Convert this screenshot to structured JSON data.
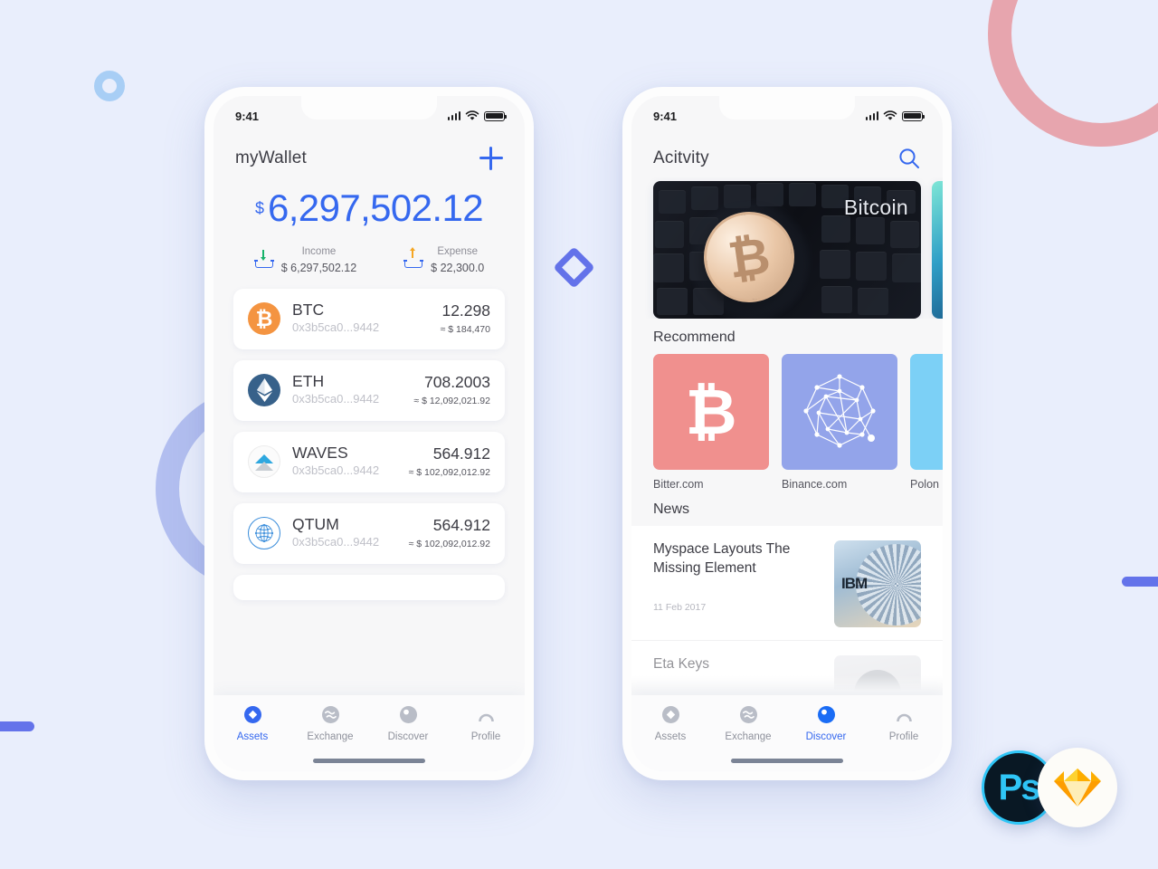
{
  "background": {
    "page_bg": "#e9eefc",
    "accent_blue": "#3568ef",
    "deco_pink": "#e7a5ae",
    "deco_periwinkle": "#b3bff0",
    "deco_lightblue": "#a8cef5",
    "deco_indigo": "#6473ea"
  },
  "wallet_screen": {
    "status": {
      "time": "9:41"
    },
    "header": {
      "title": "myWallet",
      "add_icon": "plus-icon"
    },
    "balance": {
      "currency_symbol": "$",
      "amount": "6,297,502.12"
    },
    "flows": [
      {
        "label": "Income",
        "value": "$ 6,297,502.12",
        "icon": "tray-download-icon"
      },
      {
        "label": "Expense",
        "value": "$ 22,300.0",
        "icon": "tray-upload-icon"
      }
    ],
    "assets": [
      {
        "symbol": "BTC",
        "address": "0x3b5ca0...9442",
        "qty": "12.298",
        "fiat": "≈ $ 184,470",
        "icon": "bitcoin-icon"
      },
      {
        "symbol": "ETH",
        "address": "0x3b5ca0...9442",
        "qty": "708.2003",
        "fiat": "≈ $ 12,092,021.92",
        "icon": "ethereum-icon"
      },
      {
        "symbol": "WAVES",
        "address": "0x3b5ca0...9442",
        "qty": "564.912",
        "fiat": "≈ $ 102,092,012.92",
        "icon": "waves-icon"
      },
      {
        "symbol": "QTUM",
        "address": "0x3b5ca0...9442",
        "qty": "564.912",
        "fiat": "≈ $ 102,092,012.92",
        "icon": "qtum-icon"
      }
    ],
    "tabs": [
      {
        "label": "Assets",
        "icon": "assets-icon",
        "active": true
      },
      {
        "label": "Exchange",
        "icon": "exchange-icon",
        "active": false
      },
      {
        "label": "Discover",
        "icon": "discover-icon",
        "active": false
      },
      {
        "label": "Profile",
        "icon": "profile-icon",
        "active": false
      }
    ]
  },
  "discover_screen": {
    "status": {
      "time": "9:41"
    },
    "header": {
      "title": "Acitvity",
      "search_icon": "search-icon"
    },
    "banners": [
      {
        "caption": "Bitcoin",
        "style": "keyboard-bitcoin-photo"
      },
      {
        "caption": "",
        "style": "teal-photo"
      }
    ],
    "recommend": {
      "section_title": "Recommend",
      "items": [
        {
          "name": "Bitter.com",
          "icon": "bitcoin-icon",
          "color": "#f0908e"
        },
        {
          "name": "Binance.com",
          "icon": "network-icon",
          "color": "#93a4ea"
        },
        {
          "name": "Polon",
          "icon": "poloniex-icon",
          "color": "#7cd0f6"
        }
      ]
    },
    "news": {
      "section_title": "News",
      "items": [
        {
          "title": "Myspace Layouts The Missing Element",
          "date": "11 Feb 2017",
          "thumb": "ibm-rings-photo"
        },
        {
          "title": "Eta Keys",
          "date": "",
          "thumb": "portrait-photo"
        }
      ]
    },
    "tabs": [
      {
        "label": "Assets",
        "icon": "assets-icon",
        "active": false
      },
      {
        "label": "Exchange",
        "icon": "exchange-icon",
        "active": false
      },
      {
        "label": "Discover",
        "icon": "discover-icon",
        "active": true
      },
      {
        "label": "Profile",
        "icon": "profile-icon",
        "active": false
      }
    ]
  },
  "badges": [
    {
      "name": "Ps",
      "label": "Ps"
    },
    {
      "name": "Sketch",
      "label": ""
    }
  ]
}
